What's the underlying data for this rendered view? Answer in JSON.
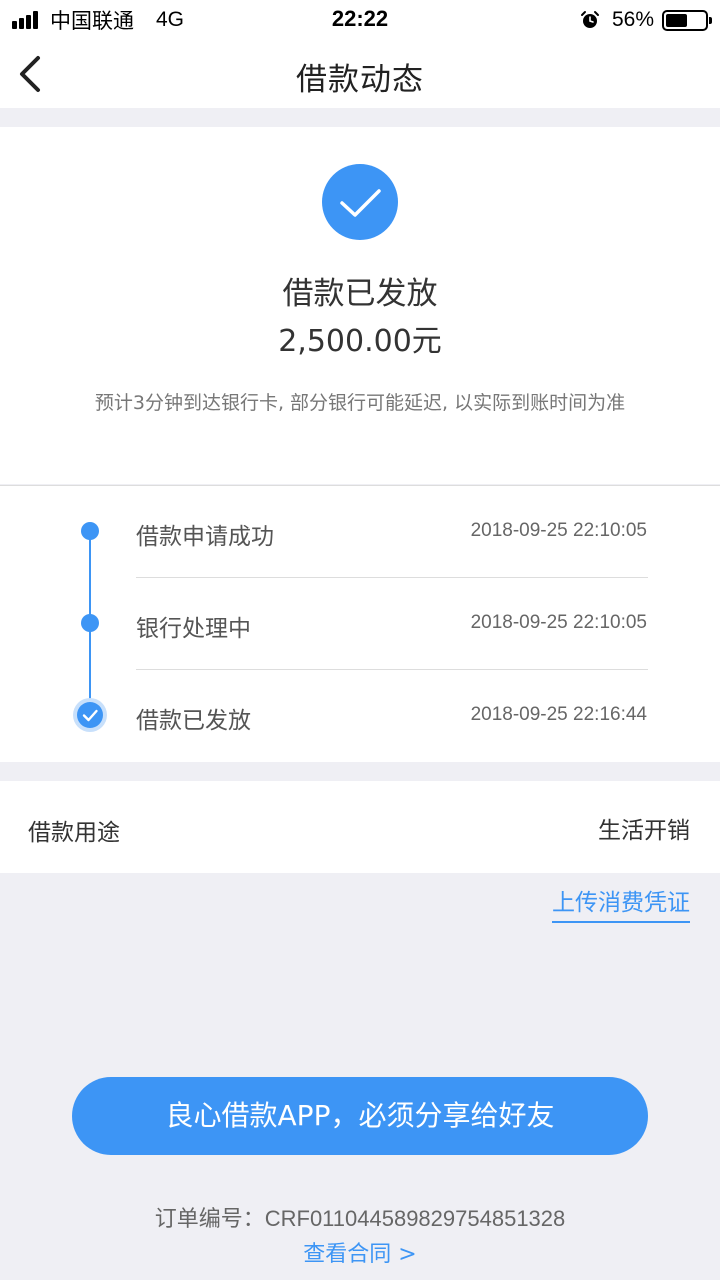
{
  "status_bar": {
    "carrier": "中国联通",
    "network": "4G",
    "time": "22:22",
    "battery": "56%",
    "battery_level": 0.56,
    "alarm_icon": "alarm-clock-icon"
  },
  "nav": {
    "title": "借款动态",
    "back_icon": "chevron-left-icon"
  },
  "status": {
    "icon": "check-circle-icon",
    "title": "借款已发放",
    "amount": "2,500.00元",
    "note": "预计3分钟到达银行卡, 部分银行可能延迟, 以实际到账时间为准"
  },
  "timeline": [
    {
      "label": "借款申请成功",
      "time": "2018-09-25 22:10:05"
    },
    {
      "label": "银行处理中",
      "time": "2018-09-25 22:10:05"
    },
    {
      "label": "借款已发放",
      "time": "2018-09-25 22:16:44"
    }
  ],
  "purpose": {
    "label": "借款用途",
    "value": "生活开销"
  },
  "upload_link": "上传消费凭证",
  "share_button": "良心借款APP，必须分享给好友",
  "order": {
    "label": "订单编号：",
    "number": "CRF0110445898297548513​28"
  },
  "contract_link": "查看合同 >",
  "colors": {
    "accent": "#3d95f5",
    "background": "#efeff4"
  }
}
